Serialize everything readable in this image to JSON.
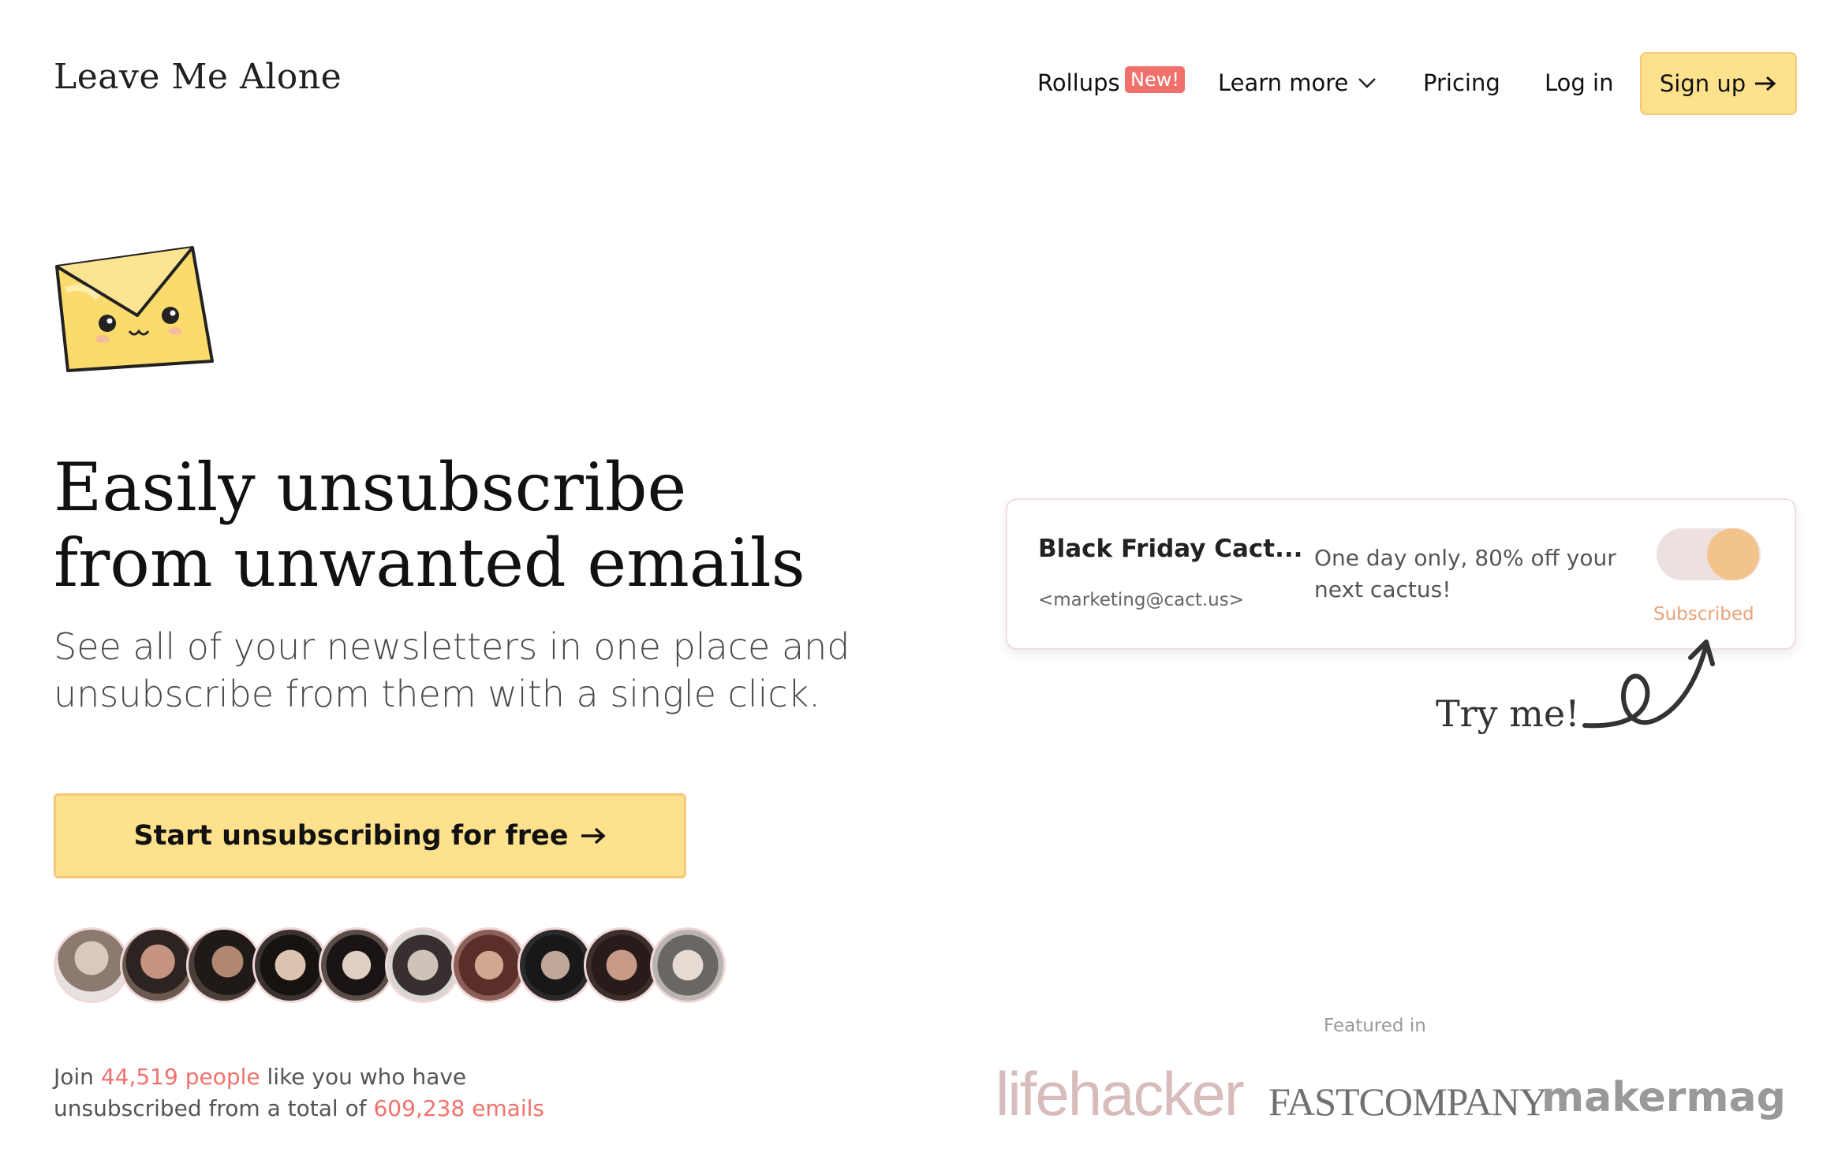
{
  "header": {
    "logo": "Leave Me Alone",
    "nav": {
      "rollups": "Rollups",
      "rollups_badge": "New!",
      "learn_more": "Learn more",
      "pricing": "Pricing",
      "log_in": "Log in",
      "sign_up": "Sign up"
    }
  },
  "hero": {
    "headline_line1": "Easily unsubscribe",
    "headline_line2": "from unwanted emails",
    "subhead_line1": "See all of your newsletters in one place and",
    "subhead_line2": "unsubscribe from them with a single click.",
    "cta": "Start unsubscribing for free",
    "join_prefix": "Join ",
    "join_people": "44,519 people",
    "join_mid": " like you who have",
    "join_line2_prefix": "unsubscribed from a total of ",
    "join_emails": "609,238 emails"
  },
  "demo_card": {
    "sender": "Black Friday Cact...",
    "email": "<marketing@cact.us>",
    "message_line1": "One day only, 80% off your",
    "message_line2": "next cactus!",
    "toggle_status": "Subscribed",
    "hint": "Try me!"
  },
  "featured": {
    "label": "Featured in",
    "logos": [
      "lifehacker",
      "FASTCOMPANY",
      "makermag"
    ]
  },
  "colors": {
    "accent_yellow": "#fee18c",
    "badge_red": "#f0716c",
    "toggle_orange": "#f2c48b"
  }
}
